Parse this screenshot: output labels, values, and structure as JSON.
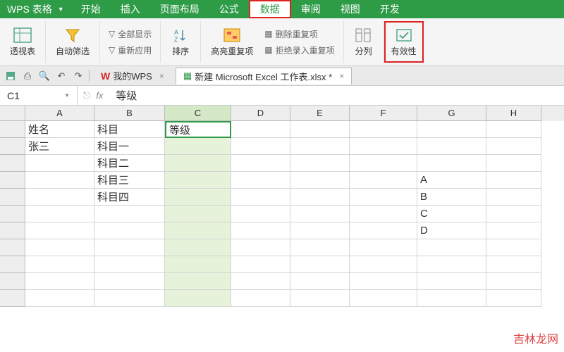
{
  "app": {
    "name": "WPS 表格"
  },
  "menu": {
    "start": "开始",
    "insert": "插入",
    "page_layout": "页面布局",
    "formulas": "公式",
    "data": "数据",
    "review": "审阅",
    "view": "视图",
    "dev": "开发"
  },
  "ribbon": {
    "pivot": "透视表",
    "autofilter": "自动筛选",
    "show_all": "全部显示",
    "reapply": "重新应用",
    "sort": "排序",
    "highlight_dup": "高亮重复项",
    "remove_dup": "删除重复项",
    "reject_dup": "拒绝录入重复项",
    "text_to_col": "分列",
    "validation": "有效性"
  },
  "tabs": {
    "my_wps": "我的WPS",
    "doc_name": "新建 Microsoft Excel 工作表.xlsx *"
  },
  "formula_bar": {
    "cell_ref": "C1",
    "fx": "fx",
    "value": "等级"
  },
  "cols": {
    "A": "A",
    "B": "B",
    "C": "C",
    "D": "D",
    "E": "E",
    "F": "F",
    "G": "G",
    "H": "H"
  },
  "cells": {
    "A1": "姓名",
    "B1": "科目",
    "C1": "等级",
    "A2": "张三",
    "B2": "科目一",
    "B3": "科目二",
    "B4": "科目三",
    "G4": "A",
    "B5": "科目四",
    "G5": "B",
    "G6": "C",
    "G7": "D"
  },
  "watermark": "吉林龙网"
}
